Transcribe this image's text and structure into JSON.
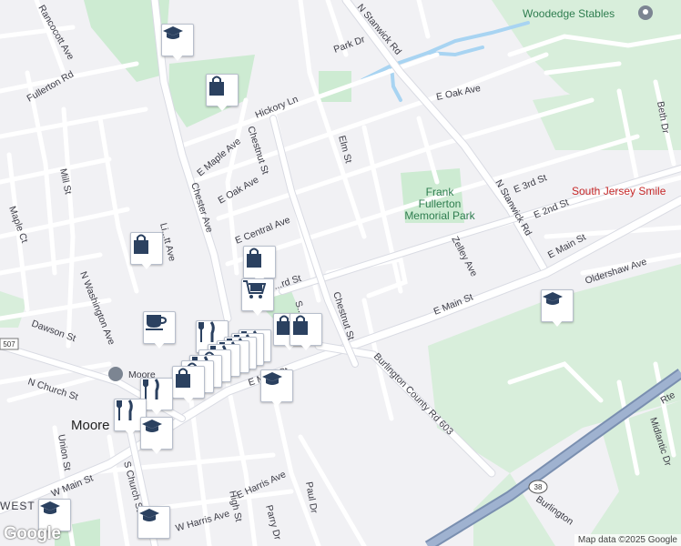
{
  "map": {
    "colors": {
      "land": "#f1f1f4",
      "park": "#cdebd2",
      "water": "#a8d4f2",
      "road": "#ffffff",
      "road_edge": "#d9dbe3",
      "highway": "#8ea2c2",
      "marker_icon": "#2b4160"
    },
    "streets": {
      "rancocott_ave": "Rancocott Ave",
      "fullerton_rd": "Fullerton Rd",
      "mill_st": "Mill St",
      "maple_ct": "Maple Ct",
      "n_washington_ave": "N Washington Ave",
      "dawson_st": "Dawson St",
      "n_church_st": "N Church St",
      "union_st": "Union St",
      "w_main_st": "W Main St",
      "s_church_st": "S Church St",
      "w_harris_ave": "W Harris Ave",
      "high_st": "High St",
      "e_harris_ave": "E Harris Ave",
      "parry_dr": "Parry Dr",
      "paul_dr": "Paul Dr",
      "chester_ave": "Chester Ave",
      "e_maple_ave": "E Maple Ave",
      "chestnut_st_n": "Chestnut St",
      "hickory_ln": "Hickory Ln",
      "e_oak_ave_w": "E Oak Ave",
      "e_central_ave": "E Central Ave",
      "e_3rd_st_w": "E 3rd St",
      "chestnut_st_s": "Chestnut St",
      "e_2nd_st_w": "E 2nd St",
      "e_main_st_w": "E Main St",
      "park_dr": "Park Dr",
      "n_stanwick_rd_top": "N Stanwick Rd",
      "e_oak_ave_e": "E Oak Ave",
      "elm_st": "Elm St",
      "n_stanwick_rd_mid": "N Stanwick Rd",
      "e_3rd_st_e": "E 3rd St",
      "e_2nd_st_e": "E 2nd St",
      "zelley_ave": "Zelley Ave",
      "e_main_st_mid": "E Main St",
      "e_main_st_e": "E Main St",
      "oldershaw_ave": "Oldershaw Ave",
      "burlington_county_rd_603": "Burlington County Rd 603",
      "beth_dr": "Beth Dr",
      "midlantic_dr": "Midlantic Dr",
      "rte": "Rte",
      "burlington": "Burlington",
      "route_38": "38",
      "route_507": "507",
      "lenola_st": "Li...tt Ave",
      "s_st": "S...St",
      "d_st": "...rd St"
    },
    "places": {
      "woodedge_stables": "Woodedge Stables",
      "frank_fullerton": "Frank Fullerton Memorial Park",
      "south_jersey_smile": "South Jersey Smile",
      "moorestown_label": "Moore",
      "moore_library": "Moore",
      "west_label": "WEST"
    },
    "attribution": "Map data ©2025 Google",
    "logo": "Google"
  }
}
